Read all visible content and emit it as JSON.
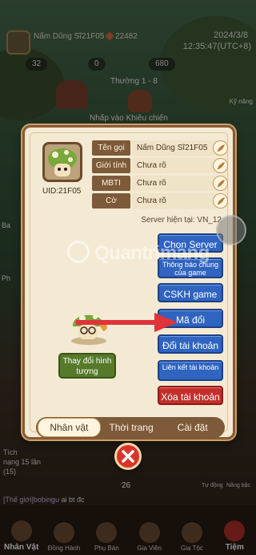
{
  "hud": {
    "player_name": "Nấm Dũng Sĩ21F05",
    "power": "22482",
    "date": "2024/3/8",
    "time": "12:35:47(UTC+8)",
    "res_1": "32",
    "res_2": "0",
    "res_3": "680",
    "stage": "Thường 1 - 8",
    "challenge_hint": "Nhấp vào Khiêu chiến",
    "skill_label": "Kỹ năng",
    "accumulate_text": "Tích",
    "accumulate_progress": "nạng 15 lần",
    "accumulate_count": "15)",
    "counter": "26",
    "auto_label": "Tự động",
    "upgrade_label": "Nâng bậc",
    "chat_channel": "[Thế giới]bobingu",
    "chat_message": "ai bt đc"
  },
  "left_side": [
    "Ba",
    "Ph"
  ],
  "bottom_nav": [
    {
      "label": "Nhân Vật",
      "icon": "character-icon"
    },
    {
      "label": "Đồng Hành",
      "icon": "companion-icon"
    },
    {
      "label": "Phụ Bản",
      "icon": "dungeon-icon"
    },
    {
      "label": "Gia Viên",
      "icon": "home-icon"
    },
    {
      "label": "Gia Tộc",
      "icon": "guild-icon"
    },
    {
      "label": "Tiệm",
      "icon": "shop-icon"
    }
  ],
  "profile": {
    "uid": "UID:21F05",
    "fields": [
      {
        "label": "Tên gọi",
        "value": "Nấm Dũng Sĩ21F05"
      },
      {
        "label": "Giới tính",
        "value": "Chưa rõ"
      },
      {
        "label": "MBTI",
        "value": "Chưa rõ"
      },
      {
        "label": "Cờ",
        "value": "Chưa rõ"
      }
    ],
    "server_label": "Server hiện tại: VN_12",
    "buttons": [
      "Chọn Server",
      "Thông báo chung của game",
      "CSKH game",
      "Mã đổi",
      "Đổi tài khoản",
      "Liên kết tài khoản",
      "Xóa tài khoản"
    ],
    "change_look": "Thay đổi hình tượng",
    "tabs": [
      "Nhân vật",
      "Thời trang",
      "Cài đặt"
    ],
    "active_tab": "Nhân vật"
  },
  "watermark": "Quantrimang",
  "colors": {
    "panel_bg": "#f4ead3",
    "panel_border": "#8a5a33",
    "label_bg": "#7d5a3a",
    "blue_button": "#2f64c0",
    "red_button": "#c3302c",
    "green_button": "#567a2a",
    "arrow": "#e0333a",
    "close": "#d9332b"
  }
}
